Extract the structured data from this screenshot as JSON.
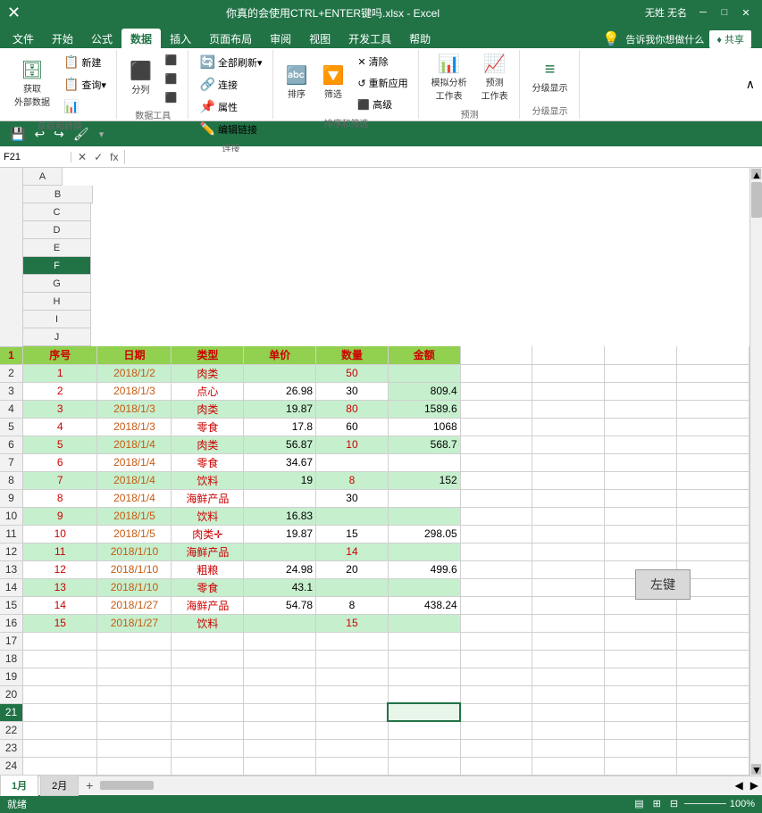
{
  "titleBar": {
    "filename": "你真的会使用CTRL+ENTER键吗.xlsx - Excel",
    "user": "无姓 无名",
    "minBtn": "─",
    "maxBtn": "□",
    "closeBtn": "✕"
  },
  "ribbonTabs": [
    "文件",
    "开始",
    "公式",
    "数据",
    "插入",
    "页面布局",
    "审阅",
    "视图",
    "开发工具",
    "帮助"
  ],
  "activeTab": "数据",
  "searchPlaceholder": "告诉我你想做什么",
  "shareLabel": "♦ 共享",
  "quickAccess": {
    "save": "💾",
    "undo": "↩",
    "redo": "↪"
  },
  "ribbonGroups": {
    "getTransform": {
      "label": "获取和转换",
      "buttons": [
        {
          "icon": "📊",
          "label": "获取\n外部数据"
        },
        {
          "icon": "📋",
          "label": "新建\n查询"
        },
        {
          "icon": "📑",
          "label": ""
        }
      ]
    },
    "dataTools": {
      "label": "数据工具",
      "buttons": [
        {
          "icon": "🔤",
          "label": "分列"
        }
      ]
    },
    "connections": {
      "label": "连接",
      "buttons": [
        {
          "icon": "🔗",
          "label": "连接"
        },
        {
          "icon": "📌",
          "label": "属性"
        },
        {
          "icon": "✏️",
          "label": "编辑链接"
        }
      ]
    },
    "sortFilter": {
      "label": "排序和筛选",
      "buttons": [
        {
          "label": "排序"
        },
        {
          "label": "筛选"
        },
        {
          "label": "清除"
        },
        {
          "label": "重新应用"
        },
        {
          "label": "高级"
        }
      ]
    },
    "forecast": {
      "label": "预测",
      "buttons": [
        {
          "icon": "📈",
          "label": "模拟分析\n工作表"
        },
        {
          "icon": "📉",
          "label": "预测\n工作表"
        }
      ]
    },
    "outline": {
      "label": "分级显示",
      "buttons": [
        {
          "icon": "≡",
          "label": "分级显示"
        }
      ]
    }
  },
  "cellRef": "F21",
  "formulaContent": "",
  "columns": [
    "A",
    "B",
    "C",
    "D",
    "E",
    "F",
    "G",
    "H",
    "I",
    "J"
  ],
  "headers": {
    "A": "序号",
    "B": "日期",
    "C": "类型",
    "D": "单价",
    "E": "数量",
    "F": "金额"
  },
  "rows": [
    {
      "rowNum": 1,
      "isHeader": true
    },
    {
      "rowNum": 2,
      "A": "1",
      "B": "2018/1/2",
      "C": "肉类",
      "D": "",
      "E": "50",
      "F": ""
    },
    {
      "rowNum": 3,
      "A": "2",
      "B": "2018/1/3",
      "C": "点心",
      "D": "26.98",
      "E": "30",
      "F": "809.4"
    },
    {
      "rowNum": 4,
      "A": "3",
      "B": "2018/1/3",
      "C": "肉类",
      "D": "19.87",
      "E": "80",
      "F": "1589.6"
    },
    {
      "rowNum": 5,
      "A": "4",
      "B": "2018/1/3",
      "C": "零食",
      "D": "17.8",
      "E": "60",
      "F": "1068"
    },
    {
      "rowNum": 6,
      "A": "5",
      "B": "2018/1/4",
      "C": "肉类",
      "D": "56.87",
      "E": "10",
      "F": "568.7"
    },
    {
      "rowNum": 7,
      "A": "6",
      "B": "2018/1/4",
      "C": "零食",
      "D": "34.67",
      "E": "",
      "F": ""
    },
    {
      "rowNum": 8,
      "A": "7",
      "B": "2018/1/4",
      "C": "饮料",
      "D": "19",
      "E": "8",
      "F": "152"
    },
    {
      "rowNum": 9,
      "A": "8",
      "B": "2018/1/4",
      "C": "海鲜产品",
      "D": "",
      "E": "30",
      "F": ""
    },
    {
      "rowNum": 10,
      "A": "9",
      "B": "2018/1/5",
      "C": "饮料",
      "D": "16.83",
      "E": "",
      "F": ""
    },
    {
      "rowNum": 11,
      "A": "10",
      "B": "2018/1/5",
      "C": "肉类✛",
      "D": "19.87",
      "E": "15",
      "F": "298.05"
    },
    {
      "rowNum": 12,
      "A": "11",
      "B": "2018/1/10",
      "C": "海鲜产品",
      "D": "",
      "E": "14",
      "F": ""
    },
    {
      "rowNum": 13,
      "A": "12",
      "B": "2018/1/10",
      "C": "粗粮",
      "D": "24.98",
      "E": "20",
      "F": "499.6"
    },
    {
      "rowNum": 14,
      "A": "13",
      "B": "2018/1/10",
      "C": "零食",
      "D": "43.1",
      "E": "",
      "F": ""
    },
    {
      "rowNum": 15,
      "A": "14",
      "B": "2018/1/27",
      "C": "海鲜产品",
      "D": "54.78",
      "E": "8",
      "F": "438.24"
    },
    {
      "rowNum": 16,
      "A": "15",
      "B": "2018/1/27",
      "C": "饮料",
      "D": "",
      "E": "15",
      "F": ""
    },
    {
      "rowNum": 17,
      "A": "",
      "B": "",
      "C": "",
      "D": "",
      "E": "",
      "F": ""
    },
    {
      "rowNum": 18,
      "A": "",
      "B": "",
      "C": "",
      "D": "",
      "E": "",
      "F": ""
    },
    {
      "rowNum": 19,
      "A": "",
      "B": "",
      "C": "",
      "D": "",
      "E": "",
      "F": ""
    },
    {
      "rowNum": 20,
      "A": "",
      "B": "",
      "C": "",
      "D": "",
      "E": "",
      "F": ""
    },
    {
      "rowNum": 21,
      "A": "",
      "B": "",
      "C": "",
      "D": "",
      "E": "",
      "F": "",
      "selected": true
    },
    {
      "rowNum": 22,
      "A": "",
      "B": "",
      "C": "",
      "D": "",
      "E": "",
      "F": ""
    },
    {
      "rowNum": 23,
      "A": "",
      "B": "",
      "C": "",
      "D": "",
      "E": "",
      "F": ""
    },
    {
      "rowNum": 24,
      "A": "",
      "B": "",
      "C": "",
      "D": "",
      "E": "",
      "F": ""
    }
  ],
  "sheetTabs": [
    "1月",
    "2月"
  ],
  "activeSheet": "1月",
  "tooltip": "左键",
  "statusBar": {
    "readyLabel": "就绪",
    "zoom": "100%"
  }
}
